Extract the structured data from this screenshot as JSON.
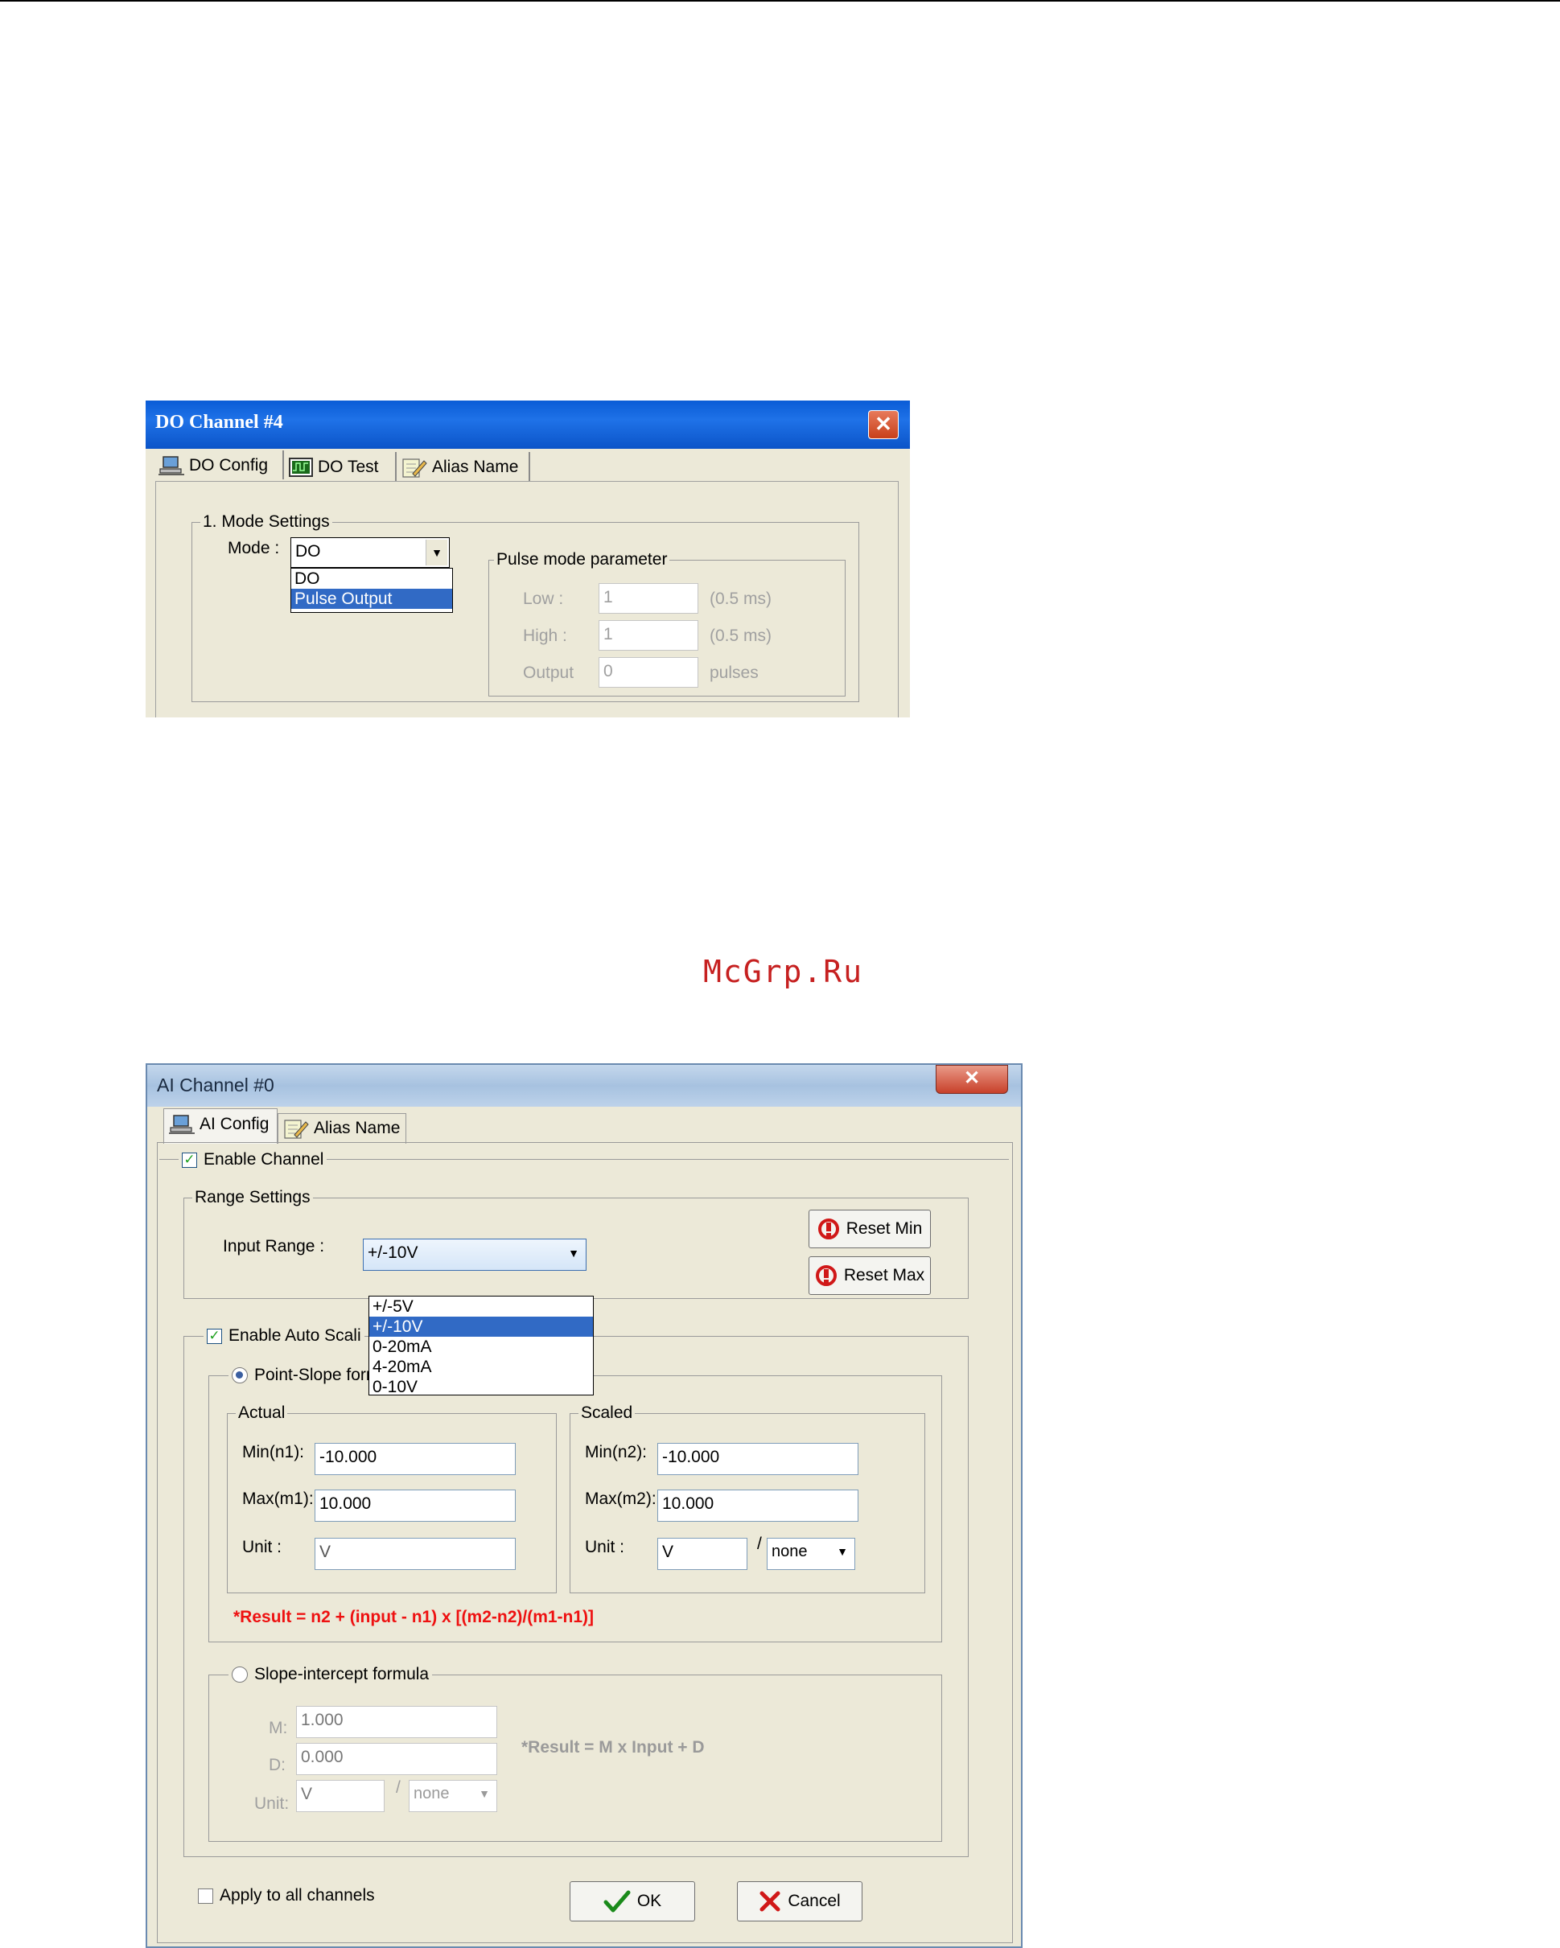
{
  "watermark": "McGrp.Ru",
  "do_dialog": {
    "title": "DO Channel #4",
    "close_glyph": "✕",
    "tabs": [
      {
        "label": "DO Config",
        "icon": "network-computer-icon"
      },
      {
        "label": "DO Test",
        "icon": "oscilloscope-icon"
      },
      {
        "label": "Alias Name",
        "icon": "edit-note-icon"
      }
    ],
    "mode_settings": {
      "legend": "1. Mode Settings",
      "mode_label": "Mode :",
      "mode_value": "DO",
      "options": [
        "DO",
        "Pulse Output"
      ],
      "selected_option": "Pulse Output"
    },
    "pulse": {
      "legend": "Pulse mode parameter",
      "low_label": "Low :",
      "low_value": "1",
      "low_unit": "(0.5 ms)",
      "high_label": "High :",
      "high_value": "1",
      "high_unit": "(0.5 ms)",
      "output_label": "Output",
      "output_value": "0",
      "output_unit": "pulses"
    }
  },
  "ai_dialog": {
    "title": "AI Channel #0",
    "close_glyph": "✕",
    "tabs": [
      {
        "label": "AI Config",
        "icon": "network-computer-icon"
      },
      {
        "label": "Alias Name",
        "icon": "edit-note-icon"
      }
    ],
    "enable_channel": {
      "label": "Enable Channel",
      "checked": true
    },
    "range": {
      "legend": "Range Settings",
      "input_range_label": "Input Range :",
      "input_range_value": "+/-10V",
      "options": [
        "+/-5V",
        "+/-10V",
        "0-20mA",
        "4-20mA",
        "0-10V"
      ],
      "selected_option": "+/-10V",
      "reset_min": "Reset Min",
      "reset_max": "Reset Max"
    },
    "auto_scaling": {
      "label": "Enable Auto Scali",
      "checked": true
    },
    "point_slope": {
      "label": "Point-Slope formula",
      "selected": true,
      "actual": {
        "legend": "Actual",
        "min_label": "Min(n1):",
        "min_value": "-10.000",
        "max_label": "Max(m1):",
        "max_value": "10.000",
        "unit_label": "Unit :",
        "unit_value": "V"
      },
      "scaled": {
        "legend": "Scaled",
        "min_label": "Min(n2):",
        "min_value": "-10.000",
        "max_label": "Max(m2):",
        "max_value": "10.000",
        "unit_label": "Unit :",
        "unit_value": "V",
        "per_value": "none"
      },
      "result": "*Result = n2 + (input - n1) x [(m2-n2)/(m1-n1)]"
    },
    "slope_intercept": {
      "label": "Slope-intercept formula",
      "selected": false,
      "m_label": "M:",
      "m_value": "1.000",
      "d_label": "D:",
      "d_value": "0.000",
      "unit_label": "Unit:",
      "unit_value": "V",
      "per_value": "none",
      "result": "*Result = M x Input + D"
    },
    "apply_all": {
      "label": "Apply to all channels",
      "checked": false
    },
    "ok_label": "OK",
    "cancel_label": "Cancel",
    "slash": "/"
  },
  "colors": {
    "selection": "#316ac5",
    "result_red": "#ee1111",
    "xp_title": "#0a5cd6"
  }
}
